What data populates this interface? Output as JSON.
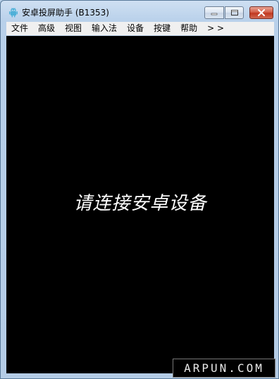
{
  "window": {
    "title": "安卓投屏助手 (B1353)",
    "app_icon": "android-icon"
  },
  "caption_buttons": {
    "minimize_icon": "minimize-icon",
    "maximize_icon": "maximize-icon",
    "close_icon": "close-icon"
  },
  "menubar": {
    "items": [
      {
        "label": "文件"
      },
      {
        "label": "高级"
      },
      {
        "label": "视图"
      },
      {
        "label": "输入法"
      },
      {
        "label": "设备"
      },
      {
        "label": "按键"
      },
      {
        "label": "帮助"
      },
      {
        "label": "> >"
      }
    ]
  },
  "screen": {
    "message": "请连接安卓设备"
  },
  "watermark": {
    "text": "ARPUN.COM"
  },
  "colors": {
    "screen_bg": "#000000",
    "title_gradient_top": "#cfe0f2",
    "close_button": "#c1371f",
    "menubar_bg": "#f0f0f0"
  }
}
